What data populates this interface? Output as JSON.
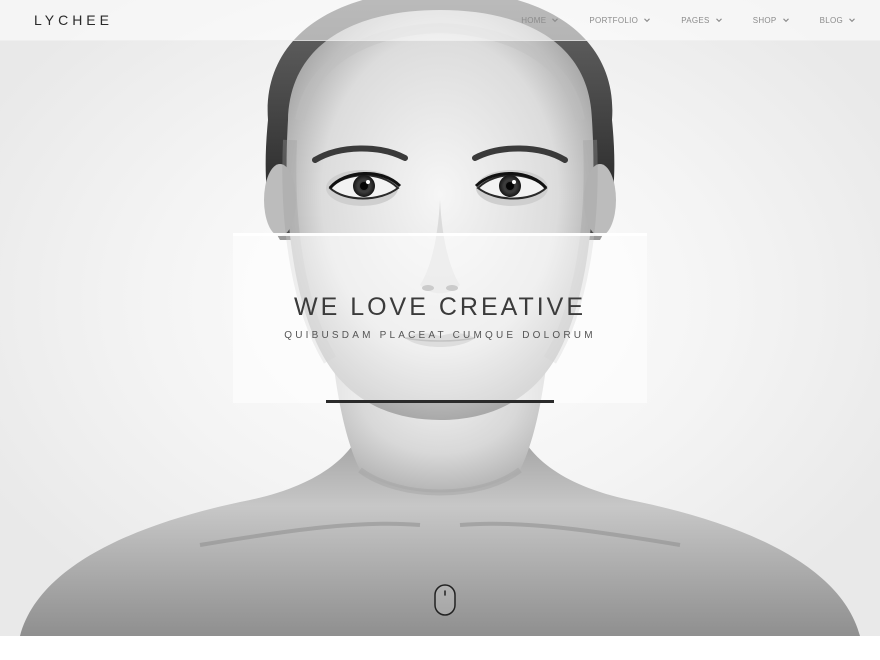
{
  "brand": {
    "logo_text": "LYCHEE"
  },
  "nav": {
    "items": [
      {
        "label": "HOME",
        "icon": "chevron-down-icon"
      },
      {
        "label": "PORTFOLIO",
        "icon": "chevron-down-icon"
      },
      {
        "label": "PAGES",
        "icon": "chevron-down-icon"
      },
      {
        "label": "SHOP",
        "icon": "chevron-down-icon"
      },
      {
        "label": "BLOG",
        "icon": "chevron-down-icon"
      }
    ]
  },
  "hero": {
    "image": "black-and-white-portrait-photo",
    "title": "WE LOVE CREATIVE",
    "subtitle": "QUIBUSDAM PLACEAT CUMQUE DOLORUM",
    "scroll_icon": "mouse-scroll-icon"
  },
  "colors": {
    "text_dark": "#2a2a2a",
    "nav_text": "#8b8b8b",
    "background": "#ffffff"
  }
}
